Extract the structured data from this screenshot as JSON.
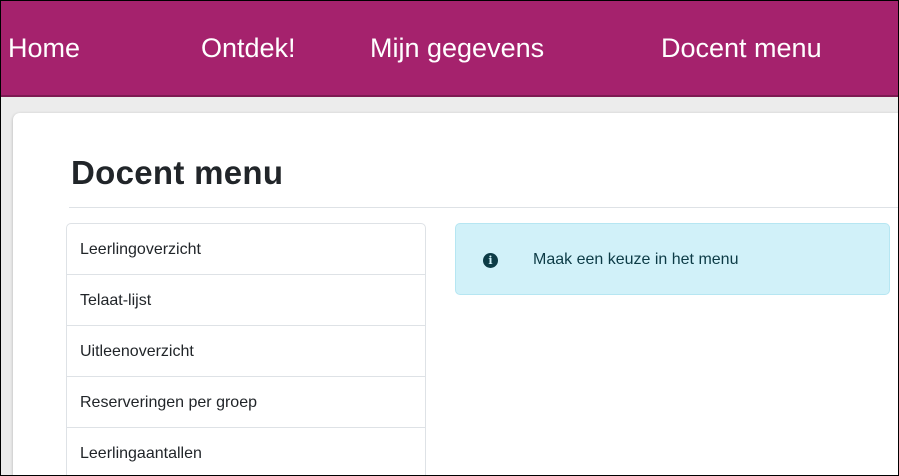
{
  "navbar": {
    "background": "#a5226d",
    "links": [
      {
        "label": "Home"
      },
      {
        "label": "Ontdek!"
      },
      {
        "label": "Mijn gegevens"
      },
      {
        "label": "Docent menu"
      }
    ]
  },
  "page": {
    "title": "Docent menu"
  },
  "menu": {
    "items": [
      {
        "label": "Leerlingoverzicht"
      },
      {
        "label": "Telaat-lijst"
      },
      {
        "label": "Uitleenoverzicht"
      },
      {
        "label": "Reserveringen per groep"
      },
      {
        "label": "Leerlingaantallen"
      }
    ]
  },
  "alert": {
    "icon": "info-icon",
    "text": "Maak een keuze in het menu",
    "background": "#d1f1f9"
  }
}
